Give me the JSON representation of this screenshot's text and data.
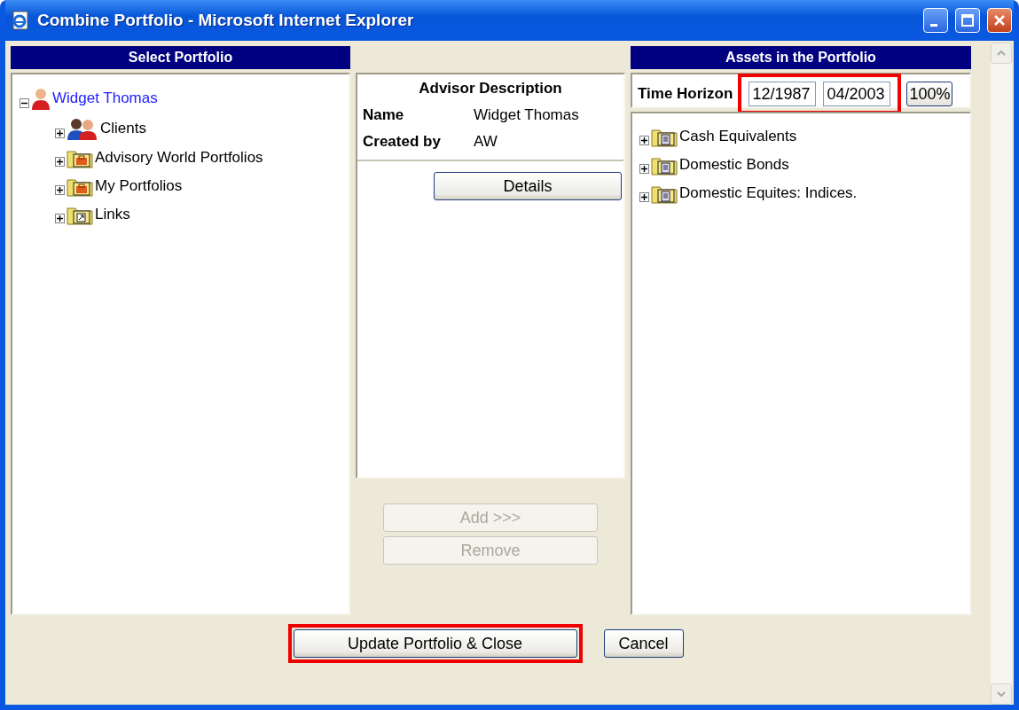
{
  "window": {
    "title": "Combine Portfolio - Microsoft Internet Explorer"
  },
  "select_portfolio": {
    "header": "Select Portfolio",
    "tree": [
      {
        "label": "Widget Thomas",
        "kind": "person",
        "expanded": true,
        "children": [
          {
            "label": "Clients",
            "kind": "people",
            "expanded": false
          },
          {
            "label": "Advisory World Portfolios",
            "kind": "briefcase-folder",
            "expanded": false
          },
          {
            "label": "My Portfolios",
            "kind": "briefcase-folder",
            "expanded": false
          },
          {
            "label": "Links",
            "kind": "link-folder",
            "expanded": false
          }
        ]
      }
    ]
  },
  "advisor": {
    "heading": "Advisor Description",
    "fields": [
      {
        "label": "Name",
        "value": "Widget Thomas"
      },
      {
        "label": "Created by",
        "value": "AW"
      }
    ],
    "details_button": "Details",
    "buttons": [
      {
        "label": "Add >>>",
        "disabled": true
      },
      {
        "label": "Remove",
        "disabled": true
      }
    ]
  },
  "assets": {
    "header": "Assets in the Portfolio",
    "time_horizon": {
      "label": "Time Horizon",
      "start": "12/1987",
      "end": "04/2003",
      "highlighted": true
    },
    "percent_button": "100%",
    "tree": [
      {
        "label": "Cash Equivalents",
        "kind": "doc-folder",
        "expanded": false
      },
      {
        "label": "Domestic Bonds",
        "kind": "doc-folder",
        "expanded": false
      },
      {
        "label": "Domestic Equites: Indices.",
        "kind": "doc-folder",
        "expanded": false
      }
    ]
  },
  "footer": {
    "buttons": [
      {
        "label": "Update Portfolio & Close",
        "highlighted": true
      },
      {
        "label": "Cancel",
        "highlighted": false
      }
    ]
  }
}
